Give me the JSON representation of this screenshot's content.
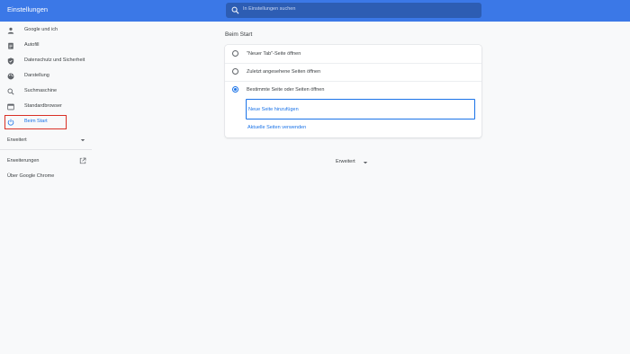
{
  "header": {
    "title": "Einstellungen",
    "search_placeholder": "In Einstellungen suchen"
  },
  "sidebar": {
    "items": [
      {
        "label": "Google und ich",
        "icon": "person-icon"
      },
      {
        "label": "Autofill",
        "icon": "clipboard-icon"
      },
      {
        "label": "Datenschutz und Sicherheit",
        "icon": "shield-icon"
      },
      {
        "label": "Darstellung",
        "icon": "palette-icon"
      },
      {
        "label": "Suchmaschine",
        "icon": "search-icon"
      },
      {
        "label": "Standardbrowser",
        "icon": "browser-icon"
      },
      {
        "label": "Beim Start",
        "icon": "power-icon"
      }
    ],
    "active_index": 6,
    "advanced_label": "Erweitert",
    "extensions_label": "Erweiterungen",
    "about_label": "Über Google Chrome"
  },
  "main": {
    "section_title": "Beim Start",
    "options": [
      {
        "label": "\"Neuer Tab\"-Seite öffnen",
        "checked": false
      },
      {
        "label": "Zuletzt angesehene Seiten öffnen",
        "checked": false
      },
      {
        "label": "Bestimmte Seite oder Seiten öffnen",
        "checked": true
      }
    ],
    "add_page_label": "Neue Seite hinzufügen",
    "use_current_label": "Aktuelle Seiten verwenden",
    "advanced_label": "Erweitert"
  },
  "colors": {
    "header_bg": "#3b78e7",
    "accent": "#1a73e8",
    "highlight_box": "#d93025"
  }
}
